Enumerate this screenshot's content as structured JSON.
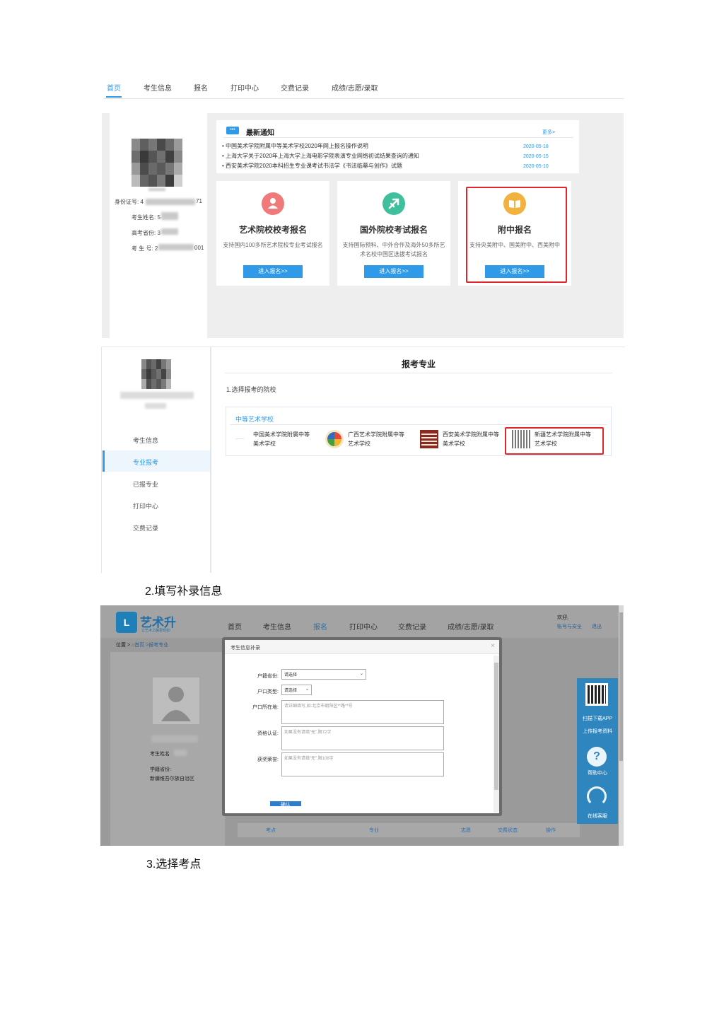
{
  "top_nav": {
    "tabs": [
      "首页",
      "考生信息",
      "报名",
      "打印中心",
      "交费记录",
      "成绩/志愿/录取"
    ],
    "active_tab": "首页"
  },
  "profile": {
    "id_label": "身份证号: 4",
    "id_tail": "71",
    "name_label": "考生姓名: 5",
    "province_label": "高考省份: 3",
    "exam_no_label": "考 生 号: 2",
    "exam_no_tail": "001"
  },
  "news": {
    "title": "最新通知",
    "more": "更多>",
    "items": [
      {
        "text": "中国美术学院附属中等美术学校2020年网上报名操作说明",
        "date": "2020-05-18"
      },
      {
        "text": "上海大学关于2020年上海大学上海电影学院表演专业网络初试结果查询的通知",
        "date": "2020-05-15"
      },
      {
        "text": "西安美术学院2020本科招生专业课考试书法学《书法临摹与创作》试题",
        "date": "2020-05-10"
      }
    ]
  },
  "cards": [
    {
      "title": "艺术院校校考报名",
      "desc": "支持国内100多所艺术院校专业考试报名",
      "button": "进入报名>>",
      "color": "#f07a7a",
      "icon": "person-icon"
    },
    {
      "title": "国外院校考试报名",
      "desc": "支持国际预科、中外合作及海外50多所艺术名校中国区选拔考试报名",
      "button": "进入报名>>",
      "color": "#3fbf9c",
      "icon": "plane-icon"
    },
    {
      "title": "附中报名",
      "desc": "支持央美附中、国美附中、西美附中",
      "button": "进入报名>>",
      "color": "#f1b23f",
      "icon": "book-icon"
    }
  ],
  "section2": {
    "nav": [
      "考生信息",
      "专业报考",
      "已报专业",
      "打印中心",
      "交费记录"
    ],
    "active_nav": "专业报考",
    "page_title": "报考专业",
    "step": "1.选择报考的院校",
    "group_title": "中等艺术学校",
    "schools": [
      {
        "line1": "中国美术学院附属中等",
        "line2": "美术学校"
      },
      {
        "line1": "广西艺术学院附属中等",
        "line2": "艺术学校"
      },
      {
        "line1": "西安美术学院附属中等",
        "line2": "美术学校"
      },
      {
        "line1": "新疆艺术学院附属中等",
        "line2": "艺术学校"
      }
    ]
  },
  "caption2": "2.填写补录信息",
  "section3": {
    "brand": "艺术升",
    "brand_slogan": "让艺术之路更轻松!",
    "nav": [
      "首页",
      "考生信息",
      "报名",
      "打印中心",
      "交费记录",
      "成绩/志愿/录取"
    ],
    "active_nav": "报名",
    "welcome": "欢迎,",
    "account": "账号与安全",
    "logout": "退出",
    "breadcrumb_prefix": "位置 >",
    "breadcrumb_home": "首页",
    "breadcrumb_current": ">报考专业",
    "student_name_label": "考生姓名",
    "province_label": "学籍省份:",
    "province_value": "新疆维吾尔族自治区",
    "dialog": {
      "title": "考生信息补录",
      "close": "×",
      "fields": [
        {
          "label": "户籍省份:",
          "value": "请选择"
        },
        {
          "label": "户口类型:",
          "value": "请选择"
        },
        {
          "label": "户口所在地:",
          "placeholder": "请详细填写,如:北京市朝阳区**路**号"
        },
        {
          "label": "资格认证:",
          "placeholder": "如果没有请填“无”,限72字"
        },
        {
          "label": "获奖荣誉:",
          "placeholder": "如果没有请填“无”,限108字"
        }
      ],
      "submit": "确认"
    },
    "side": {
      "download": "扫描下载APP",
      "upload": "上传报考资料",
      "help": "帮助中心",
      "service": "在线客服"
    },
    "table_headers": [
      "考点",
      "专业",
      "志愿",
      "交费状态",
      "操作"
    ]
  },
  "caption3": "3.选择考点"
}
